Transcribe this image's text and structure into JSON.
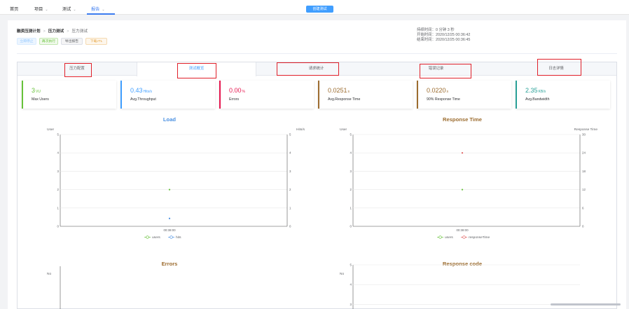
{
  "nav": {
    "home": "首页",
    "project": "项目",
    "test": "测试",
    "report": "报告",
    "create_button": "创建测试"
  },
  "breadcrumb": [
    "融资压测计划",
    "压力测试",
    "压力测试"
  ],
  "actions": {
    "stop": "立即停止",
    "rerun": "再次执行",
    "export": "导出报告",
    "download": "下载JTL"
  },
  "times": {
    "duration": "持续时间：0 分钟 3 秒",
    "start": "开始时间：2020/12/25 00:36:42",
    "end": "结束时间：2020/12/25 00:36:45"
  },
  "tabs": [
    "压力配置",
    "测试概览",
    "请求统计",
    "错误记录",
    "日志详情"
  ],
  "metrics": [
    {
      "value": "3",
      "unit": "VU",
      "label": "Max Users",
      "color": "#67c23a"
    },
    {
      "value": "0.43",
      "unit": "Hits/s",
      "label": "Avg.Throughput",
      "color": "#409eff"
    },
    {
      "value": "0.00",
      "unit": "%",
      "label": "Errors",
      "color": "#e6164e"
    },
    {
      "value": "0.0251",
      "unit": "s",
      "label": "Avg.Response Time",
      "color": "#9c6c2f"
    },
    {
      "value": "0.0220",
      "unit": "s",
      "label": "90% Response Time",
      "color": "#9c6c2f"
    },
    {
      "value": "2.35",
      "unit": "KB/s",
      "label": "Avg.Bandwidth",
      "color": "#2aa198"
    }
  ],
  "chart_data": [
    {
      "type": "scatter",
      "title": "Load",
      "title_color": "#4a90e2",
      "ylabel_left": "User",
      "ylabel_right": "Hits/s",
      "left_ticks": [
        "0",
        "1",
        "2",
        "3",
        "4",
        "5"
      ],
      "right_ticks": [
        "0",
        "1",
        "2",
        "3",
        "4",
        "5"
      ],
      "x_categories": [
        "00:38:00"
      ],
      "ylim": [
        0,
        5
      ],
      "series": [
        {
          "name": "users",
          "color": "#67c23a",
          "values": [
            2
          ]
        },
        {
          "name": "hits",
          "color": "#4a90e2",
          "values": [
            0.43
          ]
        }
      ]
    },
    {
      "type": "scatter",
      "title": "Response Time",
      "title_color": "#9c6c2f",
      "ylabel_left": "User",
      "ylabel_right": "Response Time",
      "left_ticks": [
        "0",
        "1",
        "2",
        "3",
        "4",
        "5"
      ],
      "right_ticks": [
        "0",
        "6",
        "12",
        "18",
        "24",
        "30"
      ],
      "x_categories": [
        "00:38:00"
      ],
      "ylim": [
        0,
        5
      ],
      "series": [
        {
          "name": "users",
          "color": "#67c23a",
          "values": [
            2
          ]
        },
        {
          "name": "responseTime",
          "color": "#e05b5b",
          "values": [
            4
          ]
        }
      ]
    },
    {
      "type": "scatter",
      "title": "Errors",
      "title_color": "#9c6c2f",
      "ylabel_left": "No"
    },
    {
      "type": "bar",
      "title": "Response code",
      "title_color": "#9c6c2f",
      "ylabel_left": "No",
      "left_ticks": [
        "3",
        "4",
        "5"
      ],
      "ylim": [
        0,
        5
      ]
    }
  ]
}
